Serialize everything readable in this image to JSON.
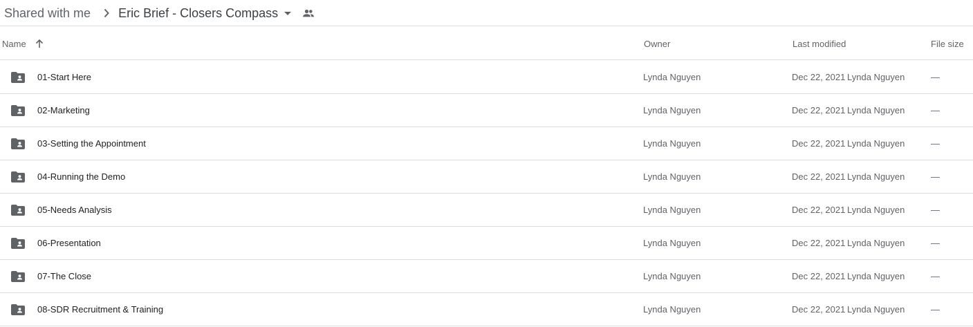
{
  "breadcrumb": {
    "root_label": "Shared with me",
    "current_label": "Eric Brief - Closers Compass"
  },
  "columns": {
    "name": "Name",
    "owner": "Owner",
    "last_modified": "Last modified",
    "file_size": "File size"
  },
  "colors": {
    "folder_icon": "#5f6368",
    "divider": "#dadce0",
    "primary_text": "#202124",
    "secondary_text": "#5f6368"
  },
  "files": [
    {
      "name": "01-Start Here",
      "owner": "Lynda Nguyen",
      "modified_date": "Dec 22, 2021",
      "modified_by": "Lynda Nguyen",
      "size": "—",
      "icon": "shared-folder-icon"
    },
    {
      "name": "02-Marketing",
      "owner": "Lynda Nguyen",
      "modified_date": "Dec 22, 2021",
      "modified_by": "Lynda Nguyen",
      "size": "—",
      "icon": "shared-folder-icon"
    },
    {
      "name": "03-Setting the Appointment",
      "owner": "Lynda Nguyen",
      "modified_date": "Dec 22, 2021",
      "modified_by": "Lynda Nguyen",
      "size": "—",
      "icon": "shared-folder-icon"
    },
    {
      "name": "04-Running the Demo",
      "owner": "Lynda Nguyen",
      "modified_date": "Dec 22, 2021",
      "modified_by": "Lynda Nguyen",
      "size": "—",
      "icon": "shared-folder-icon"
    },
    {
      "name": "05-Needs Analysis",
      "owner": "Lynda Nguyen",
      "modified_date": "Dec 22, 2021",
      "modified_by": "Lynda Nguyen",
      "size": "—",
      "icon": "shared-folder-icon"
    },
    {
      "name": "06-Presentation",
      "owner": "Lynda Nguyen",
      "modified_date": "Dec 22, 2021",
      "modified_by": "Lynda Nguyen",
      "size": "—",
      "icon": "shared-folder-icon"
    },
    {
      "name": "07-The Close",
      "owner": "Lynda Nguyen",
      "modified_date": "Dec 22, 2021",
      "modified_by": "Lynda Nguyen",
      "size": "—",
      "icon": "shared-folder-icon"
    },
    {
      "name": "08-SDR Recruitment & Training",
      "owner": "Lynda Nguyen",
      "modified_date": "Dec 22, 2021",
      "modified_by": "Lynda Nguyen",
      "size": "—",
      "icon": "shared-folder-icon"
    }
  ]
}
